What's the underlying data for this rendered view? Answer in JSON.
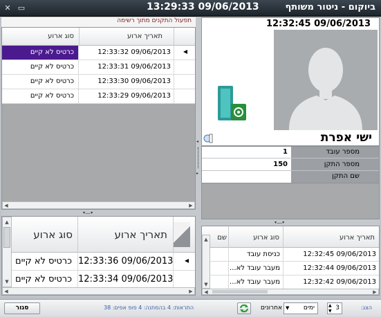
{
  "window": {
    "title": "ביוקום - ניטור משותף",
    "clock": "13:29:33 09/06/2013",
    "min_glyph": "▭",
    "close_glyph": "✕"
  },
  "person": {
    "timestamp": "12:32:45 09/06/2013",
    "name": "ישי אפרת",
    "fields": [
      {
        "label": "מספר עובד",
        "value": "1"
      },
      {
        "label": "מספר התקן",
        "value": "150"
      },
      {
        "label": "שם התקן",
        "value": ""
      }
    ]
  },
  "top_events": {
    "title": "תפעול התקנים מתוך רשימה",
    "columns": [
      "תאריך ארוע",
      "סוג ארוע"
    ],
    "rows": [
      {
        "date": "12:33:32 09/06/2013",
        "type": "כרטיס לא קיים",
        "selected": true
      },
      {
        "date": "12:33:31 09/06/2013",
        "type": "כרטיס לא קיים",
        "selected": false
      },
      {
        "date": "12:33:30 09/06/2013",
        "type": "כרטיס לא קיים",
        "selected": false
      },
      {
        "date": "12:33:29 09/06/2013",
        "type": "כרטיס לא קיים",
        "selected": false
      }
    ]
  },
  "large_events": {
    "columns": [
      "תאריך ארוע",
      "סוג ארוע"
    ],
    "rows": [
      {
        "date": "12:33:36 09/06/2013",
        "type": "כרטיס לא קיים"
      },
      {
        "date": "12:33:34 09/06/2013",
        "type": "כרטיס לא קיים"
      }
    ]
  },
  "employee_events": {
    "columns": [
      "תאריך ארוע",
      "סוג ארוע",
      "שם"
    ],
    "rows": [
      {
        "date": "12:32:45 09/06/2013",
        "type": "כניסת עובד"
      },
      {
        "date": "12:32:44 09/06/2013",
        "type": "מעבר עובד לא..."
      },
      {
        "date": "12:32:42 09/06/2013",
        "type": "מעבר עובד לא..."
      }
    ]
  },
  "bottom": {
    "alerts_label": "הצג:",
    "days_value": "3",
    "units_label": "ימים",
    "last_label": "אחרונים",
    "stats": "התראות: 4   בהמתנה: 4   פופ אפים: 38",
    "close_label": "סגור"
  },
  "colors": {
    "selected_row": "#4b1a8f",
    "stats_text": "#3a5fa8"
  }
}
